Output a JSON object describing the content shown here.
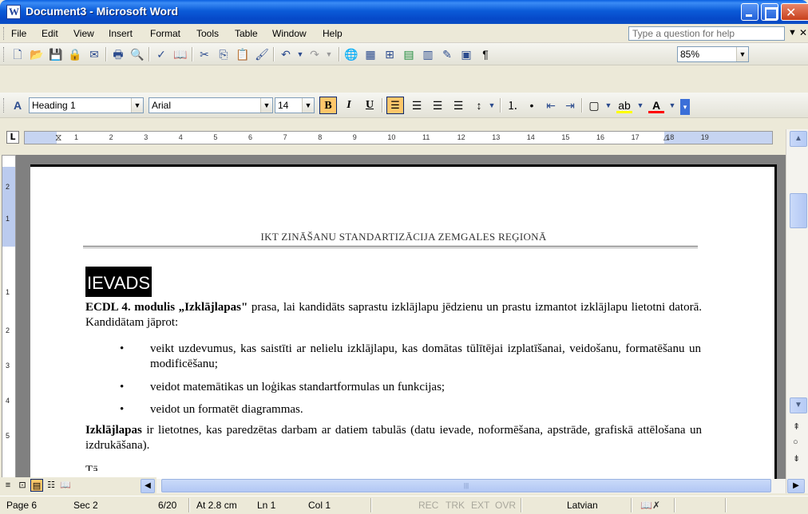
{
  "window": {
    "title": "Document3 - Microsoft Word"
  },
  "menu": {
    "items": [
      "File",
      "Edit",
      "View",
      "Insert",
      "Format",
      "Tools",
      "Table",
      "Window",
      "Help"
    ],
    "help_placeholder": "Type a question for help"
  },
  "standard_toolbar": {
    "zoom": "85%"
  },
  "formatting_toolbar": {
    "style": "Heading 1",
    "font": "Arial",
    "size": "14",
    "bold": "B",
    "italic": "I",
    "underline": "U"
  },
  "ruler": {
    "ticks": [
      "1",
      "2",
      "3",
      "4",
      "5",
      "6",
      "7",
      "8",
      "9",
      "10",
      "11",
      "12",
      "13",
      "14",
      "15",
      "16",
      "17",
      "18",
      "19"
    ]
  },
  "vruler": {
    "ticks": [
      "2",
      "1",
      "1",
      "2",
      "3",
      "4",
      "5"
    ]
  },
  "document": {
    "header": "IKT ZINĀŠANU STANDARTIZĀCIJA ZEMGALES REĢIONĀ",
    "heading": "IEVADS",
    "intro_bold": "ECDL 4. modulis „Izklājlapas\"",
    "intro_rest": " prasa, lai kandidāts saprastu izklājlapu jēdzienu un prastu izmantot izklājlapu lietotni datorā. Kandidātam jāprot:",
    "bullets": [
      "veikt uzdevumus, kas saistīti ar nelielu izklājlapu, kas domātas tūlītējai izplatīšanai, veidošanu, formatēšanu un modificēšanu;",
      "veidot matemātikas un loģikas standartformulas un funkcijas;",
      "veidot un formatēt diagrammas."
    ],
    "bullet_symbol": "•",
    "para2_bold": "Izklājlapas",
    "para2_rest": " ir lietotnes, kas paredzētas darbam ar datiem tabulās (datu ievade, noformēšana, apstrāde, grafiskā attēlošana un izdrukāšana).",
    "para3_partial": "Tā"
  },
  "status": {
    "page": "Page 6",
    "sec": "Sec 2",
    "pos": "6/20",
    "at": "At 2.8 cm",
    "ln": "Ln 1",
    "col": "Col 1",
    "rec": "REC",
    "trk": "TRK",
    "ext": "EXT",
    "ovr": "OVR",
    "language": "Latvian"
  }
}
